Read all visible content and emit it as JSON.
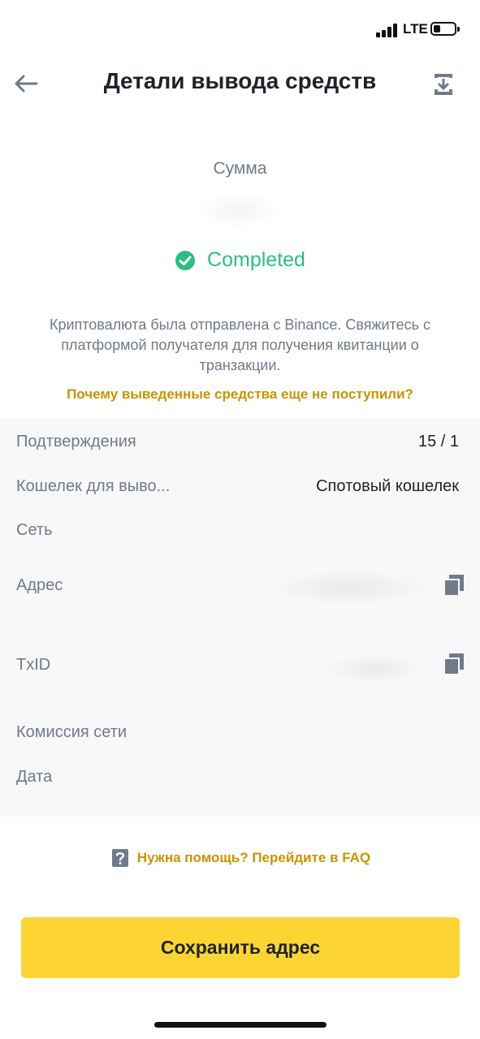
{
  "status_bar": {
    "network": "LTE",
    "battery_level": 0.2,
    "signal_bars": 4
  },
  "header": {
    "title": "Детали вывода средств"
  },
  "amount": {
    "label": "Сумма"
  },
  "status": {
    "text": "Completed",
    "color": "#2ebd85"
  },
  "notice": {
    "text": "Криптовалюта была отправлена с Binance. Свяжитесь с платформой получателя для получения квитанции о транзакции.",
    "link": "Почему выведенные средства еще не поступили?"
  },
  "details": {
    "confirmations": {
      "label": "Подтверждения",
      "value": "15 / 1"
    },
    "wallet": {
      "label": "Кошелек для выво...",
      "value": "Спотовый кошелек"
    },
    "network": {
      "label": "Сеть"
    },
    "address": {
      "label": "Адрес"
    },
    "txid": {
      "label": "TxID"
    },
    "fee": {
      "label": "Комиссия сети"
    },
    "date": {
      "label": "Дата"
    }
  },
  "help": {
    "text": "Нужна помощь? Перейдите в FAQ"
  },
  "save_button": {
    "label": "Сохранить адрес"
  },
  "colors": {
    "accent": "#fcd535",
    "link": "#c99400",
    "success": "#2ebd85",
    "muted": "#707a8a"
  },
  "icons": [
    "back-arrow-icon",
    "download-icon",
    "check-circle-icon",
    "copy-icon",
    "question-icon"
  ]
}
